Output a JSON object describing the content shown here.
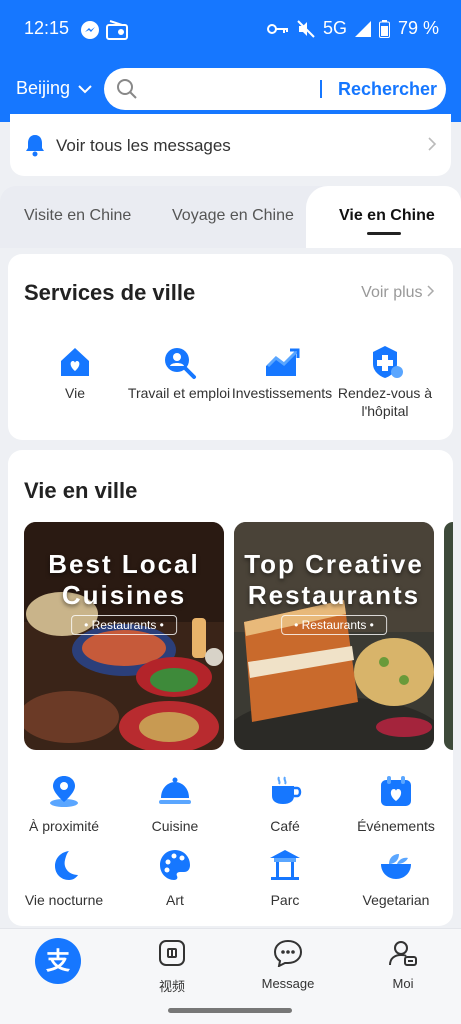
{
  "status_bar": {
    "time": "12:15",
    "network": "5G",
    "battery": "79 %"
  },
  "header": {
    "city": "Beijing",
    "search_placeholder": "",
    "search_button": "Rechercher"
  },
  "messages": {
    "label": "Voir tous les messages"
  },
  "tabs": [
    {
      "label": "Visite en Chine",
      "active": false
    },
    {
      "label": "Voyage en Chine",
      "active": false
    },
    {
      "label": "Vie en Chine",
      "active": true
    }
  ],
  "services": {
    "title": "Services de ville",
    "more": "Voir plus",
    "items": [
      {
        "label": "Vie",
        "icon": "house-icon"
      },
      {
        "label": "Travail et emploi",
        "icon": "job-search-icon"
      },
      {
        "label": "Investissements",
        "icon": "trend-chart-icon"
      },
      {
        "label": "Rendez-vous à l'hôpital",
        "icon": "medical-icon"
      }
    ]
  },
  "city_life": {
    "title": "Vie en ville",
    "banners": [
      {
        "title_line1": "Best Local",
        "title_line2": "Cuisines",
        "tag": "• Restaurants •"
      },
      {
        "title_line1": "Top Creative",
        "title_line2": "Restaurants",
        "tag": "• Restaurants •"
      }
    ],
    "categories": [
      {
        "label": "À proximité",
        "icon": "location-pin-icon"
      },
      {
        "label": "Cuisine",
        "icon": "food-cloche-icon"
      },
      {
        "label": "Café",
        "icon": "coffee-cup-icon"
      },
      {
        "label": "Événements",
        "icon": "calendar-heart-icon"
      },
      {
        "label": "Vie nocturne",
        "icon": "moon-icon"
      },
      {
        "label": "Art",
        "icon": "palette-icon"
      },
      {
        "label": "Parc",
        "icon": "pavilion-icon"
      },
      {
        "label": "Vegetarian",
        "icon": "veg-bowl-icon"
      }
    ]
  },
  "bottom_nav": [
    {
      "label": "",
      "icon": "alipay-logo-icon"
    },
    {
      "label": "视频",
      "icon": "video-icon"
    },
    {
      "label": "Message",
      "icon": "chat-bubble-icon"
    },
    {
      "label": "Moi",
      "icon": "user-icon"
    }
  ],
  "colors": {
    "brand_blue": "#1677ff",
    "page_bg": "#eef0f4"
  }
}
